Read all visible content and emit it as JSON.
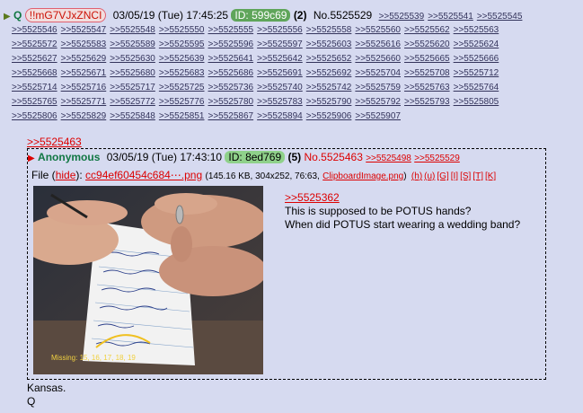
{
  "op": {
    "arrow": "▶",
    "name": "Q",
    "tripcode": "!!mG7VJxZNCI",
    "datetime": "03/05/19 (Tue) 17:45:25",
    "id": "ID: 599c69",
    "count": "(2)",
    "postno": "No.5525529"
  },
  "backlinks": [
    [
      ">>5525539",
      ">>5525541",
      ">>5525545"
    ],
    [
      ">>5525546",
      ">>5525547",
      ">>5525548",
      ">>5525550",
      ">>5525555",
      ">>5525556",
      ">>5525558",
      ">>5525560",
      ">>5525562",
      ">>5525563"
    ],
    [
      ">>5525572",
      ">>5525583",
      ">>5525589",
      ">>5525595",
      ">>5525596",
      ">>5525597",
      ">>5525603",
      ">>5525616",
      ">>5525620",
      ">>5525624"
    ],
    [
      ">>5525627",
      ">>5525629",
      ">>5525630",
      ">>5525639",
      ">>5525641",
      ">>5525642",
      ">>5525652",
      ">>5525660",
      ">>5525665",
      ">>5525666"
    ],
    [
      ">>5525668",
      ">>5525671",
      ">>5525680",
      ">>5525683",
      ">>5525686",
      ">>5525691",
      ">>5525692",
      ">>5525704",
      ">>5525708",
      ">>5525712"
    ],
    [
      ">>5525714",
      ">>5525716",
      ">>5525717",
      ">>5525725",
      ">>5525736",
      ">>5525740",
      ">>5525742",
      ">>5525759",
      ">>5525763",
      ">>5525764"
    ],
    [
      ">>5525765",
      ">>5525771",
      ">>5525772",
      ">>5525776",
      ">>5525780",
      ">>5525783",
      ">>5525790",
      ">>5525792",
      ">>5525793",
      ">>5525805"
    ],
    [
      ">>5525806",
      ">>5525829",
      ">>5525848",
      ">>5525851",
      ">>5525867",
      ">>5525894",
      ">>5525906",
      ">>5525907"
    ]
  ],
  "quote_link": ">>5525463",
  "reply": {
    "arrow": "▶",
    "name": "Anonymous",
    "datetime": "03/05/19 (Tue) 17:43:10",
    "id": "ID: 8ed769",
    "count": "(5)",
    "postno": "No.5525463",
    "backlinks": [
      ">>5525498",
      ">>5525529"
    ],
    "file_label": "File",
    "hide": "hide",
    "filename": "cc94ef60454c684⋯.png",
    "fileinfo": "(145.16 KB, 304x252, 76:63,",
    "clipname": "ClipboardImage.png",
    "search_links": [
      "(h)",
      "(u)",
      "[G]",
      "[I]",
      "[S]",
      "[T]",
      "[K]"
    ],
    "image_caption": "Missing: 15, 16, 17, 18, 19",
    "msg_quote": ">>5525362",
    "msg_lines": [
      "This is supposed to be POTUS hands?",
      "When did POTUS start wearing a wedding band?"
    ]
  },
  "after_lines": [
    "Kansas.",
    "Q"
  ]
}
